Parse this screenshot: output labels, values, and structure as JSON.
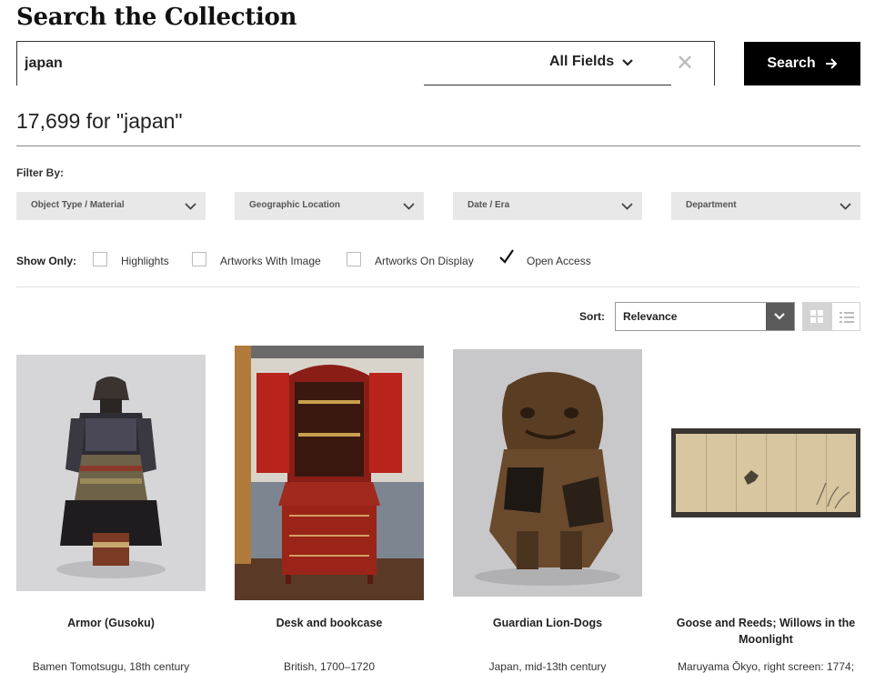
{
  "page_title": "Search the Collection",
  "search": {
    "query": "japan",
    "field_select": "All Fields",
    "button_label": "Search"
  },
  "results": {
    "count_text": "17,699 for \"japan\""
  },
  "filters": {
    "label": "Filter By:",
    "dropdowns": [
      "Object Type / Material",
      "Geographic Location",
      "Date / Era",
      "Department"
    ]
  },
  "show_only": {
    "label": "Show Only:",
    "options": [
      {
        "label": "Highlights",
        "checked": false
      },
      {
        "label": "Artworks With Image",
        "checked": false
      },
      {
        "label": "Artworks On Display",
        "checked": false
      },
      {
        "label": "Open Access",
        "checked": true
      }
    ]
  },
  "sort": {
    "label": "Sort:",
    "value": "Relevance"
  },
  "view": {
    "active": "grid"
  },
  "cards": [
    {
      "title": "Armor (Gusoku)",
      "meta": "Bamen Tomotsugu, 18th century"
    },
    {
      "title": "Desk and bookcase",
      "meta": "British, 1700–1720"
    },
    {
      "title": "Guardian Lion-Dogs",
      "meta": "Japan, mid-13th century"
    },
    {
      "title": "Goose and Reeds; Willows in the Moonlight",
      "meta": "Maruyama Ōkyo, right screen: 1774;"
    }
  ],
  "colors": {
    "search_button_bg": "#000000",
    "filter_bg": "#e8e8e8",
    "sort_button_bg": "#5a5a5a"
  }
}
